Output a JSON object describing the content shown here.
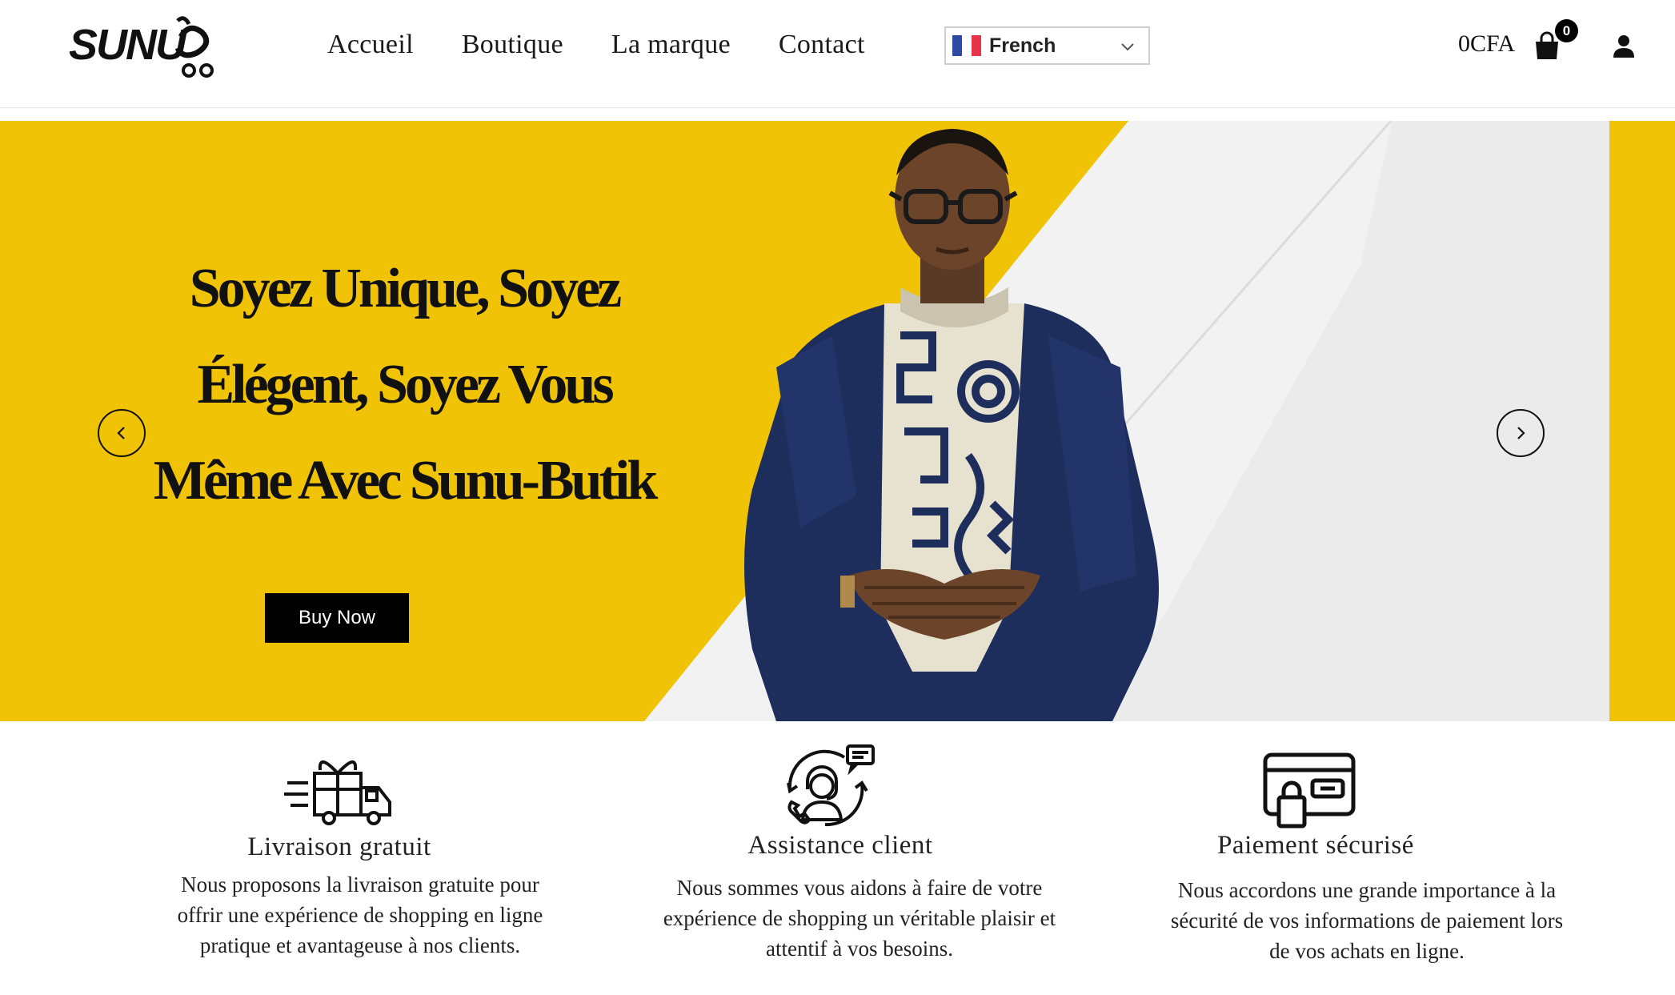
{
  "header": {
    "logo_text": "SUNU",
    "nav": [
      "Accueil",
      "Boutique",
      "La marque",
      "Contact"
    ],
    "language": {
      "selected": "French",
      "flag": "france-flag"
    },
    "cart": {
      "total": "0CFA",
      "count": "0"
    },
    "icons": {
      "cart": "shopping-bag-icon",
      "account": "user-icon",
      "dropdown": "chevron-down-icon"
    }
  },
  "hero": {
    "title_lines": [
      "Soyez Unique, Soyez",
      "Élégent, Soyez Vous",
      "Même Avec Sunu-Butik"
    ],
    "button": "Buy Now",
    "colors": {
      "accent": "#f0c306",
      "panel": "#f3f3f3",
      "button": "#000000"
    },
    "icons": {
      "prev": "chevron-left-icon",
      "next": "chevron-right-icon"
    }
  },
  "features": [
    {
      "icon": "delivery-truck-gift-icon",
      "title": "Livraison gratuit",
      "desc": [
        "Nous proposons la livraison gratuite pour",
        "offrir une expérience de shopping en ligne",
        "pratique et avantageuse à nos clients."
      ]
    },
    {
      "icon": "customer-support-icon",
      "title": "Assistance client",
      "desc": [
        "Nous sommes vous aidons à faire de votre",
        "expérience de shopping un véritable plaisir et",
        "attentif à vos besoins."
      ]
    },
    {
      "icon": "secure-card-payment-icon",
      "title": "Paiement sécurisé",
      "desc": [
        "Nous accordons une grande importance à la",
        "sécurité de vos informations de paiement lors",
        "de vos achats en ligne."
      ]
    }
  ]
}
